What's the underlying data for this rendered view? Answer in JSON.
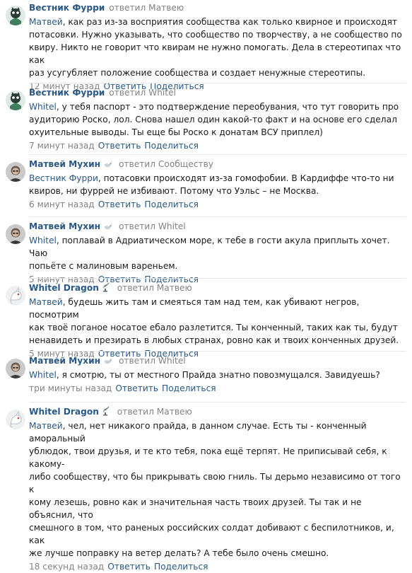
{
  "comments": [
    {
      "author": "Вестник Фурри",
      "author_kind": "group",
      "replied_text": "ответил Матвею",
      "reply_to": "Матвей",
      "lines": [
        ", как раз из-за восприятия сообщества как только квирное и происходят",
        "потасовки. Нужно указывать, что сообщество по творчеству, а не сообщество по",
        "квиру. Никто не говорит что квирам не нужно помогать. Дела в стереотипах что как",
        "раз усугубляет положение сообщества и создает ненужные стереотипы."
      ],
      "time": "12 минут назад",
      "reply_label": "Ответить",
      "share_label": "Поделиться"
    },
    {
      "author": "Вестник Фурри",
      "author_kind": "group",
      "replied_text": "ответил Whitel",
      "reply_to": "Whitel",
      "lines": [
        ", у тебя паспорт - это подтверждение переобувания, что тут говорить про",
        "аудиторию Роско, лол. Снова нашел один какой-то факт и на основе его сделал",
        "охуительные выводы. Ты еще бы Роско к донатам ВСУ приплел)"
      ],
      "time": "7 минут назад",
      "reply_label": "Ответить",
      "share_label": "Поделиться"
    },
    {
      "author": "Матвей Мухин",
      "author_kind": "user",
      "badge_icon": "dove-icon",
      "replied_text": "ответил Сообществу",
      "reply_to": "Вестник Фурри",
      "lines": [
        ", потасовки происходят из-за гомофобии. В Кардиффе что-то ни",
        "квиров, ни фуррей не избивают. Потому что Уэльс – не Москва."
      ],
      "time": "6 минут назад",
      "reply_label": "Ответить",
      "share_label": "Поделиться"
    },
    {
      "author": "Матвей Мухин",
      "author_kind": "user",
      "badge_icon": "dove-icon",
      "replied_text": "ответил Whitel",
      "reply_to": "Whitel",
      "lines": [
        ", поплавай в Адриатическом море, к тебе в гости акула приплыть хочет. Чаю",
        "попьёте с малиновым вареньем."
      ],
      "time": "5 минут назад",
      "reply_label": "Ответить",
      "share_label": "Поделиться"
    },
    {
      "author": "Whitel Dragon",
      "author_kind": "user-dragon",
      "badge_icon": "satellite-dish-icon",
      "replied_text": "ответил Матвею",
      "reply_to": "Матвей",
      "lines": [
        ", будешь жить там и смеяться там над тем, как убивают негров, посмотрим",
        "как твоё поганое носатое ебало разлетится. Ты конченный, таких как ты, будут",
        "ненавидеть и презирать в любых странах, ровно как и твоих конченных друзей."
      ],
      "time": "5 минут назад",
      "reply_label": "Ответить",
      "share_label": "Поделиться"
    },
    {
      "author": "Матвей Мухин",
      "author_kind": "user",
      "badge_icon": "dove-icon",
      "replied_text": "ответил Whitel",
      "reply_to": "Whitel",
      "lines": [
        ", я смотрю, ты от местного Прайда знатно повозмущался. Завидуешь?"
      ],
      "time": "три минуты назад",
      "reply_label": "Ответить",
      "share_label": "Поделиться"
    },
    {
      "author": "Whitel Dragon",
      "author_kind": "user-dragon",
      "badge_icon": "satellite-dish-icon",
      "replied_text": "ответил Матвею",
      "reply_to": "Матвей",
      "lines": [
        ", чел, нет никакого прайда, в данном случае. Есть ты - конченный аморальный",
        "ублюдок, твои друзья, и те кто тебя, пока ещё терпят. Не приписывай себя, к какому-",
        "либо сообществу, что бы прикрывать свою гниль. Ты дерьмо независимо от того к",
        "кому лезешь, ровно как и значительная часть твоих друзей. Ты так и не объяснил, что",
        "смешного в том, что раненых российских солдат добивают с беспилотников, и, как",
        "же лучше поправку на ветер делать? А тебе было очень смешно."
      ],
      "time": "18 секунд назад",
      "reply_label": "Ответить",
      "share_label": "Поделиться"
    }
  ]
}
